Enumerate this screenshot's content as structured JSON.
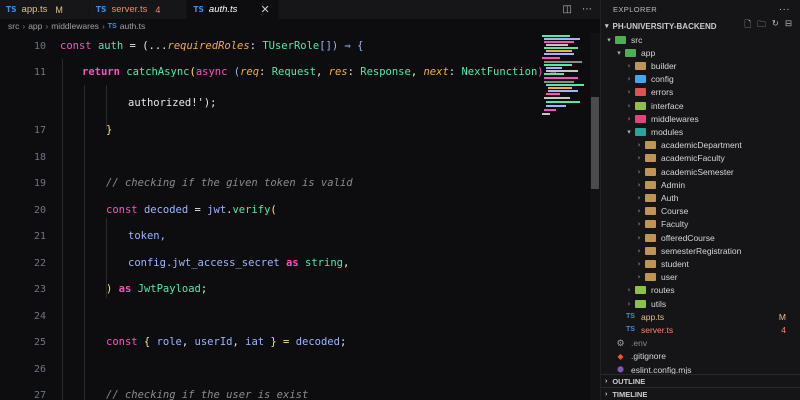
{
  "tabs": [
    {
      "icon": "TS",
      "name": "app.ts",
      "badge": "M",
      "state": "modified"
    },
    {
      "icon": "TS",
      "name": "server.ts",
      "badge": "4",
      "state": "error"
    },
    {
      "icon": "TS",
      "name": "auth.ts",
      "badge": "",
      "state": "active",
      "close": "✕"
    }
  ],
  "tab_actions": [
    "split-editor-icon",
    "more-icon"
  ],
  "breadcrumb": [
    "src",
    "app",
    "middlewares",
    "auth.ts"
  ],
  "breadcrumb_ts": "TS",
  "line_numbers": [
    "10",
    "11",
    "",
    "17",
    "18",
    "19",
    "20",
    "21",
    "22",
    "23",
    "24",
    "25",
    "26",
    "27"
  ],
  "code": {
    "l10": {
      "const": "const",
      "auth": "auth",
      "eq": " = (",
      "spread": "...",
      "param": "requiredRoles",
      "colon": ": ",
      "type": "TUserRole",
      "rest": "[]) ⇒ {"
    },
    "l11": {
      "ret": "return",
      "fn": "catchAsync",
      "open": "(",
      "async": "async",
      "p1open": " (",
      "req": "req",
      "c1": ": ",
      "t1": "Request",
      "comma1": ", ",
      "res": "res",
      "c2": ": ",
      "t2": "Response",
      "comma2": ", ",
      "next": "next",
      "c3": ": ",
      "t3": "NextFunction",
      "arrow": ") ⇒"
    },
    "l_auth": {
      "text": "authorized!');"
    },
    "l17": {
      "text": "}"
    },
    "l19": {
      "text": "// checking if the given token is valid"
    },
    "l20": {
      "const": "const",
      "name": "decoded",
      "eq": " = ",
      "obj": "jwt",
      "dot": ".",
      "fn": "verify",
      "open": "("
    },
    "l21": {
      "text": "token,"
    },
    "l22": {
      "obj": "config",
      "prop": ".jwt_access_secret ",
      "as": "as",
      "sp": " ",
      "type": "string",
      "end": ","
    },
    "l23": {
      "close": ") ",
      "as": "as",
      "sp": " ",
      "type": "JwtPayload",
      "end": ";"
    },
    "l25": {
      "const": "const",
      "open": " { ",
      "a": "role",
      "c1": ", ",
      "b": "userId",
      "c2": ", ",
      "c": "iat",
      "close": " } = ",
      "val": "decoded",
      "end": ";"
    },
    "l27": {
      "text": "// checking if the user is exist"
    }
  },
  "explorer": {
    "title": "EXPLORER",
    "more": "···",
    "project": "PH-UNIVERSITY-BACKEND",
    "project_actions": [
      "new-file-icon",
      "new-folder-icon",
      "refresh-icon",
      "collapse-icon"
    ],
    "tree": [
      {
        "label": "src",
        "depth": 0,
        "open": true,
        "kind": "folder-src",
        "color": "#4caf50"
      },
      {
        "label": "app",
        "depth": 1,
        "open": true,
        "kind": "folder-app",
        "color": "#4caf50"
      },
      {
        "label": "builder",
        "depth": 2,
        "open": false,
        "kind": "folder",
        "color": "#c09553"
      },
      {
        "label": "config",
        "depth": 2,
        "open": false,
        "kind": "folder",
        "color": "#42a5f5"
      },
      {
        "label": "errors",
        "depth": 2,
        "open": false,
        "kind": "folder",
        "color": "#e05252"
      },
      {
        "label": "interface",
        "depth": 2,
        "open": false,
        "kind": "folder",
        "color": "#8bc34a"
      },
      {
        "label": "middlewares",
        "depth": 2,
        "open": false,
        "kind": "folder",
        "color": "#ec407a"
      },
      {
        "label": "modules",
        "depth": 2,
        "open": true,
        "kind": "folder-modules",
        "color": "#26a69a"
      },
      {
        "label": "academicDepartment",
        "depth": 3,
        "open": false,
        "kind": "folder",
        "color": "#c09553"
      },
      {
        "label": "academicFaculty",
        "depth": 3,
        "open": false,
        "kind": "folder",
        "color": "#c09553"
      },
      {
        "label": "academicSemester",
        "depth": 3,
        "open": false,
        "kind": "folder",
        "color": "#c09553"
      },
      {
        "label": "Admin",
        "depth": 3,
        "open": false,
        "kind": "folder",
        "color": "#c09553"
      },
      {
        "label": "Auth",
        "depth": 3,
        "open": false,
        "kind": "folder",
        "color": "#c09553"
      },
      {
        "label": "Course",
        "depth": 3,
        "open": false,
        "kind": "folder",
        "color": "#c09553"
      },
      {
        "label": "Faculty",
        "depth": 3,
        "open": false,
        "kind": "folder",
        "color": "#c09553"
      },
      {
        "label": "offeredCourse",
        "depth": 3,
        "open": false,
        "kind": "folder",
        "color": "#c09553"
      },
      {
        "label": "semesterRegistration",
        "depth": 3,
        "open": false,
        "kind": "folder",
        "color": "#c09553"
      },
      {
        "label": "student",
        "depth": 3,
        "open": false,
        "kind": "folder",
        "color": "#c09553"
      },
      {
        "label": "user",
        "depth": 3,
        "open": false,
        "kind": "folder",
        "color": "#c09553"
      },
      {
        "label": "routes",
        "depth": 2,
        "open": false,
        "kind": "folder",
        "color": "#8bc34a"
      },
      {
        "label": "utils",
        "depth": 2,
        "open": false,
        "kind": "folder",
        "color": "#8bc34a"
      },
      {
        "label": "app.ts",
        "depth": 1,
        "kind": "ts",
        "status": "M",
        "state": "modified"
      },
      {
        "label": "server.ts",
        "depth": 1,
        "kind": "ts",
        "status": "4",
        "state": "error"
      },
      {
        "label": ".env",
        "depth": 0,
        "kind": "gear",
        "state": "dim"
      },
      {
        "label": ".gitignore",
        "depth": 0,
        "kind": "git"
      },
      {
        "label": "eslint.config.mjs",
        "depth": 0,
        "kind": "eslint"
      }
    ],
    "sections": [
      "OUTLINE",
      "TIMELINE"
    ]
  },
  "colors": {
    "keyword": "#ff4fbf",
    "function": "#4eeaa8",
    "param": "#f0ad44",
    "comment": "#8b8b8b",
    "modified": "#e2c08d",
    "error": "#f48771",
    "ts": "#3b8eea"
  }
}
